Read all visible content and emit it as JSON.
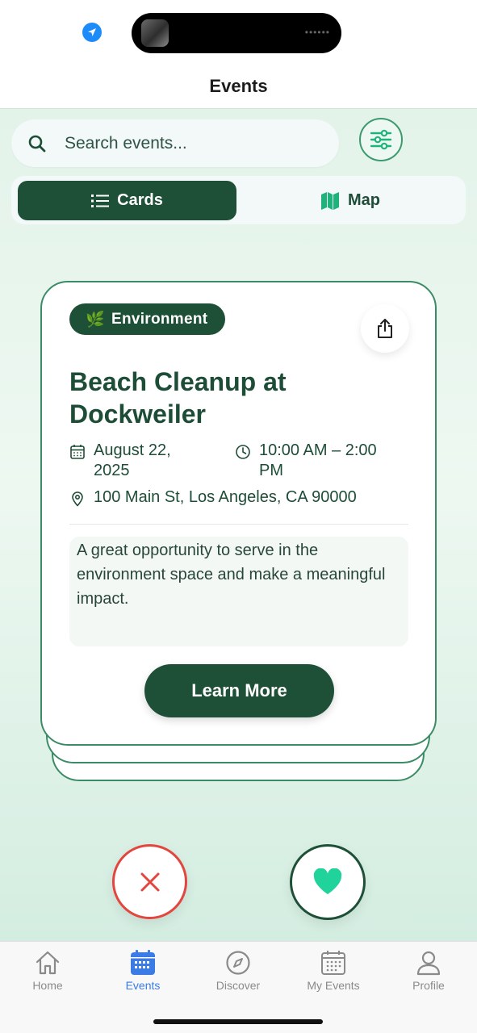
{
  "header": {
    "title": "Events"
  },
  "search": {
    "placeholder": "Search events..."
  },
  "view_toggle": {
    "cards_label": "Cards",
    "map_label": "Map",
    "active": "Cards"
  },
  "event": {
    "category": "Environment",
    "category_icon": "🌿",
    "title": "Beach Cleanup at Dockweiler",
    "date": "August 22, 2025",
    "time": "10:00 AM – 2:00 PM",
    "location": "100 Main St, Los Angeles, CA 90000",
    "description": "A great opportunity to serve in the environment space and make a meaningful impact.",
    "cta_label": "Learn More"
  },
  "actions": {
    "pass_icon": "close-icon",
    "like_icon": "heart-icon"
  },
  "tabbar": {
    "items": [
      {
        "label": "Home",
        "icon": "home-icon"
      },
      {
        "label": "Events",
        "icon": "calendar-icon"
      },
      {
        "label": "Discover",
        "icon": "compass-icon"
      },
      {
        "label": "My Events",
        "icon": "calendar-grid-icon"
      },
      {
        "label": "Profile",
        "icon": "person-icon"
      }
    ],
    "active": "Events"
  },
  "colors": {
    "primary": "#1e5038",
    "accent": "#3b8c66",
    "active_tab": "#3b7be6",
    "pass": "#e2463f",
    "heart": "#1fd39a"
  }
}
